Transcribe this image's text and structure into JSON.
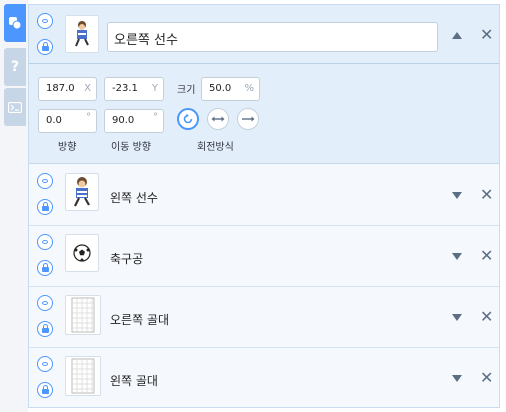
{
  "tabs": [
    {
      "name": "objects",
      "icon": "objects-icon"
    },
    {
      "name": "help",
      "icon": "help-icon",
      "label": "?"
    },
    {
      "name": "console",
      "icon": "console-icon"
    }
  ],
  "selected": {
    "name": "오른쪽 선수",
    "x": "187.0",
    "x_unit": "X",
    "y": "-23.1",
    "y_unit": "Y",
    "size_label": "크기",
    "size": "50.0",
    "size_unit": "%",
    "direction": "0.0",
    "direction_unit": "°",
    "move_direction": "90.0",
    "move_direction_unit": "°",
    "direction_label": "방향",
    "move_direction_label": "이동 방향",
    "rotation_label": "회전방식"
  },
  "objects": [
    {
      "name": "왼쪽 선수",
      "thumb": "player"
    },
    {
      "name": "축구공",
      "thumb": "ball"
    },
    {
      "name": "오른쪽 골대",
      "thumb": "goal"
    },
    {
      "name": "왼쪽 골대",
      "thumb": "goal"
    }
  ],
  "close_glyph": "✕",
  "colors": {
    "accent": "#4c97ff",
    "panel": "#e2eef9"
  }
}
